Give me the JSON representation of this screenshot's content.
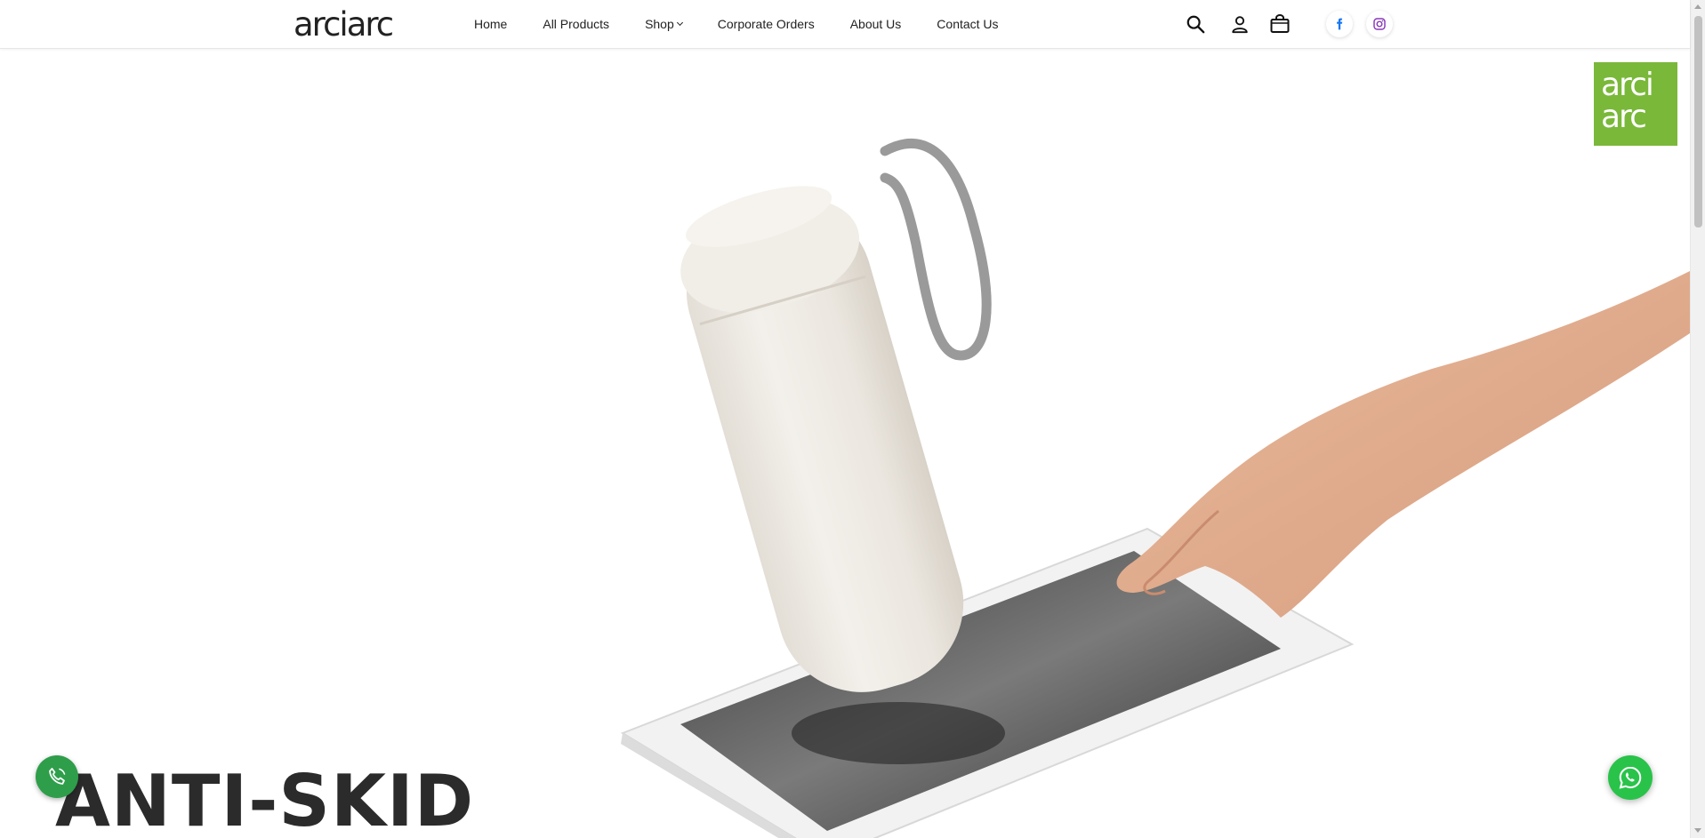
{
  "brand": {
    "logo_text": "arciarc",
    "badge_line1": "arci",
    "badge_line2": "arc",
    "badge_color": "#7ab83a"
  },
  "nav": {
    "items": [
      {
        "label": "Home"
      },
      {
        "label": "All Products"
      },
      {
        "label": "Shop",
        "has_dropdown": true
      },
      {
        "label": "Corporate Orders"
      },
      {
        "label": "About Us"
      },
      {
        "label": "Contact Us"
      }
    ]
  },
  "header_icons": [
    "search-icon",
    "account-icon",
    "shopping-bag-icon"
  ],
  "social": [
    {
      "name": "facebook-icon",
      "color": "#1877f2"
    },
    {
      "name": "instagram-icon",
      "color": "#8a3ab9"
    }
  ],
  "hero": {
    "headline": "ANTI-SKID"
  },
  "floating": {
    "call_color": "#2e9e4a",
    "whatsapp_color": "#29c34a"
  }
}
